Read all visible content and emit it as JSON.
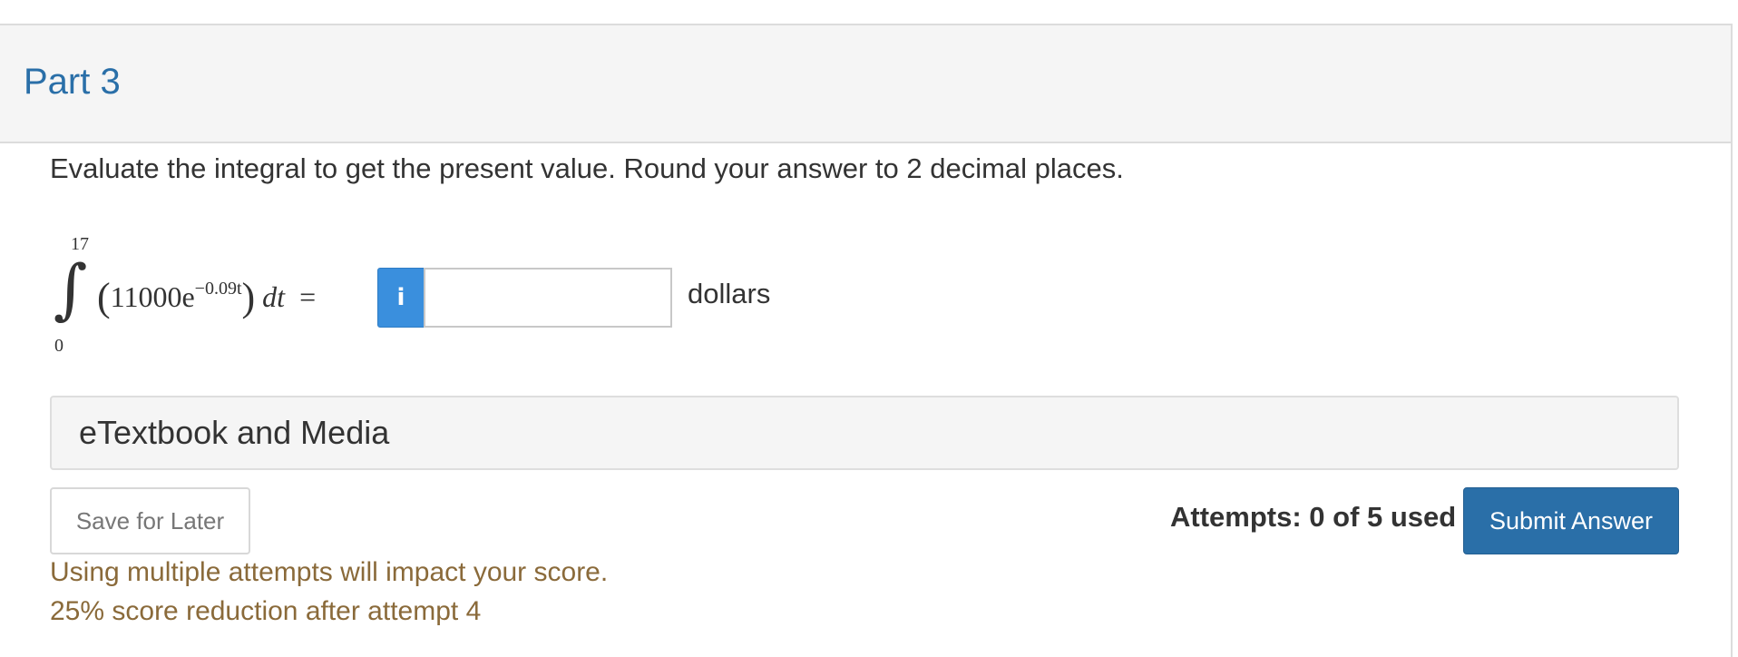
{
  "part": {
    "title": "Part 3"
  },
  "question": {
    "text": "Evaluate the integral to get the present value. Round your answer to 2 decimal places."
  },
  "math": {
    "upper_limit": "17",
    "lower_limit": "0",
    "coefficient": "11000e",
    "exponent": "−0.09t",
    "differential": "dt",
    "equals": "="
  },
  "answer": {
    "info_icon": "i",
    "value": "",
    "placeholder": "",
    "unit": "dollars"
  },
  "etextbook": {
    "label": "eTextbook and Media"
  },
  "actions": {
    "save_label": "Save for Later",
    "attempts_text": "Attempts: 0 of 5 used",
    "submit_label": "Submit Answer"
  },
  "warnings": {
    "line1": "Using multiple attempts will impact your score.",
    "line2": "25% score reduction after attempt 4"
  },
  "colors": {
    "title_blue": "#2a6fa8",
    "info_blue": "#3a8fdd",
    "submit_blue": "#2a6fa8",
    "warning_brown": "#8a6a3a"
  }
}
